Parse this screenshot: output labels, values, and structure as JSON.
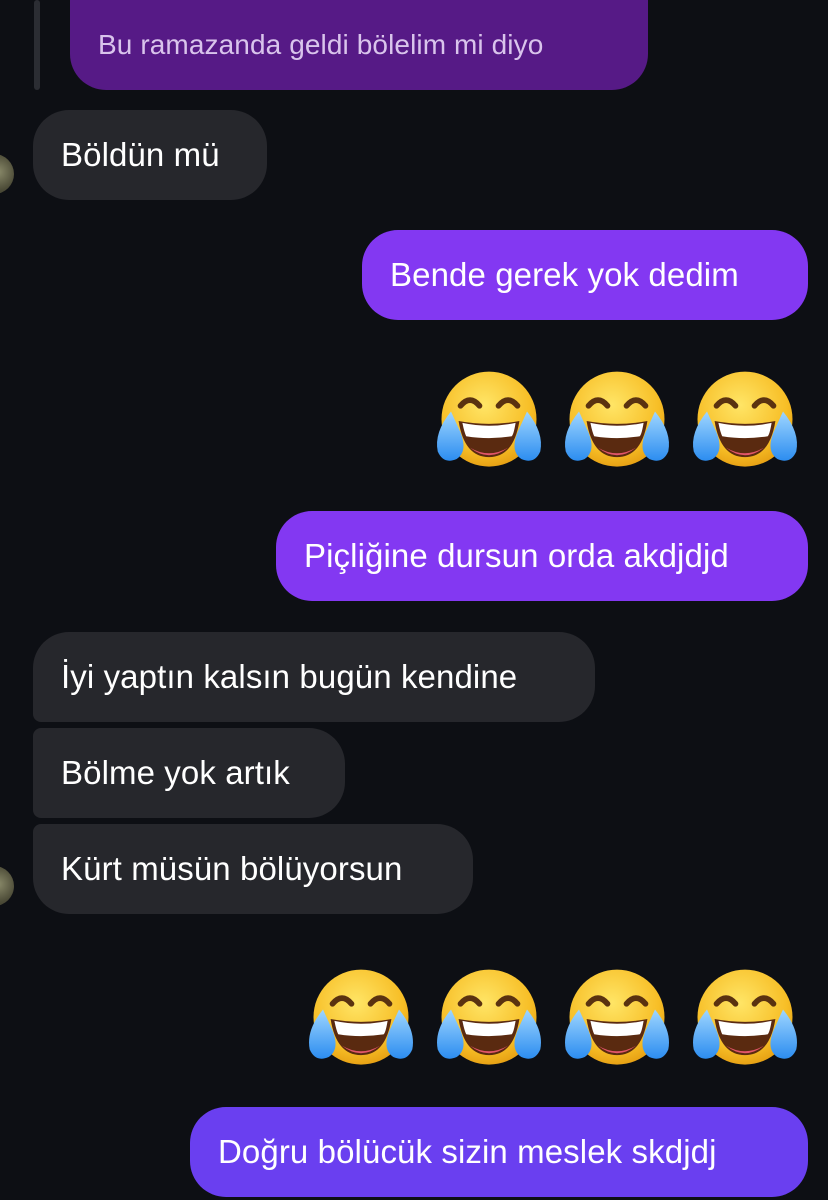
{
  "chat": {
    "quoted_message": "Bu ramazanda geldi bölelim mi diyo",
    "messages": [
      {
        "side": "in",
        "text": "Böldün mü"
      },
      {
        "side": "out",
        "text": "Bende gerek yok dedim"
      },
      {
        "side": "out",
        "text": "Piçliğine dursun orda akdjdjd"
      },
      {
        "side": "in",
        "text": "İyi yaptın kalsın bugün kendine"
      },
      {
        "side": "in",
        "text": "Bölme yok artık"
      },
      {
        "side": "in",
        "text": "Kürt müsün bölüyorsun"
      },
      {
        "side": "out",
        "text": "Doğru bölücük sizin meslek skdjdj"
      }
    ],
    "emoji_rows": [
      {
        "emoji": "face-with-tears-of-joy-icon",
        "count": 3
      },
      {
        "emoji": "face-with-tears-of-joy-icon",
        "count": 4
      }
    ]
  },
  "colors": {
    "background": "#0d0f14",
    "incoming_bubble": "#26272c",
    "outgoing_bubble": "#8338f2",
    "outgoing_bubble_last": "#6a3ff0",
    "quoted_bubble": "#561a86"
  }
}
